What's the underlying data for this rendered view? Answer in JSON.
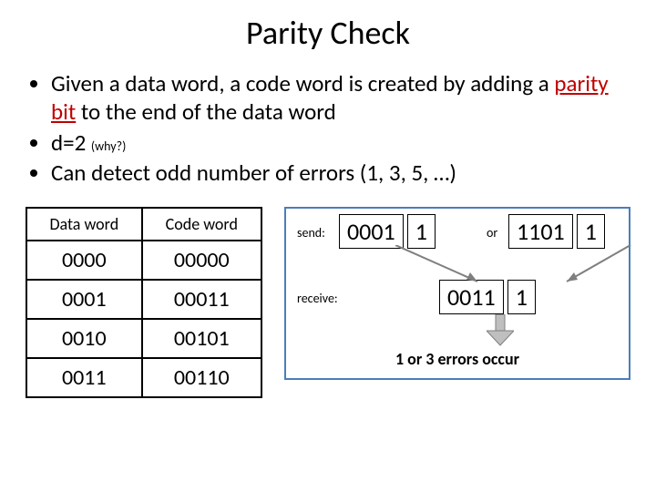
{
  "title": "Parity Check",
  "bullets": {
    "b0_pre": "Given a data word, a code word is created by adding a ",
    "b0_red": "parity bit",
    "b0_post": " to the end of the data word",
    "b1_main": "d=2 ",
    "b1_why": "(why?)",
    "b2": "Can detect odd number of errors (1, 3, 5, …)"
  },
  "table": {
    "headers": {
      "data": "Data word",
      "code": "Code word"
    },
    "rows": [
      {
        "data": "0000",
        "code": "00000"
      },
      {
        "data": "0001",
        "code": "00011"
      },
      {
        "data": "0010",
        "code": "00101"
      },
      {
        "data": "0011",
        "code": "00110"
      }
    ]
  },
  "diagram": {
    "send_label": "send:",
    "or_label": "or",
    "receive_label": "receive:",
    "cw1_data": "0001",
    "cw1_parity": "1",
    "cw2_data": "1101",
    "cw2_parity": "1",
    "cw3_data": "0011",
    "cw3_parity": "1",
    "caption": "1 or 3 errors occur"
  }
}
